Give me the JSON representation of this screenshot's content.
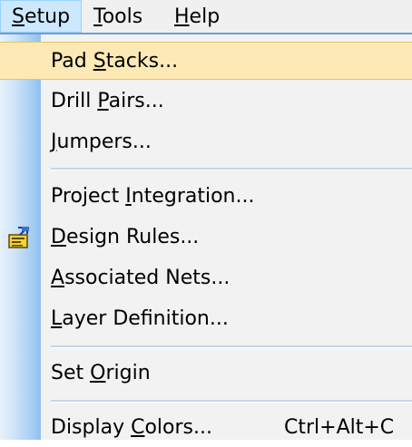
{
  "menubar": {
    "setup": {
      "pre": "",
      "key": "S",
      "post": "etup"
    },
    "tools": {
      "pre": "",
      "key": "T",
      "post": "ools"
    },
    "help": {
      "pre": "",
      "key": "H",
      "post": "elp"
    }
  },
  "menu": {
    "pad_stacks": {
      "pre": "Pad ",
      "key": "S",
      "post": "tacks..."
    },
    "drill_pairs": {
      "pre": "Drill ",
      "key": "P",
      "post": "airs..."
    },
    "jumpers": {
      "pre": "",
      "key": "J",
      "post": "umpers..."
    },
    "project_integration": {
      "pre": "Project ",
      "key": "I",
      "post": "ntegration..."
    },
    "design_rules": {
      "pre": "",
      "key": "D",
      "post": "esign Rules...",
      "icon": "design-rules-icon"
    },
    "associated_nets": {
      "pre": "",
      "key": "A",
      "post": "ssociated Nets..."
    },
    "layer_definition": {
      "pre": "",
      "key": "L",
      "post": "ayer Definition..."
    },
    "set_origin": {
      "pre": "Set ",
      "key": "O",
      "post": "rigin"
    },
    "display_colors": {
      "pre": "Display ",
      "key": "C",
      "post": "olors...",
      "shortcut": "Ctrl+Alt+C"
    }
  },
  "colors": {
    "highlight": "#fde9b6",
    "menubar_active": "#cce8ff",
    "icon_gutter": "#a9cff3"
  }
}
